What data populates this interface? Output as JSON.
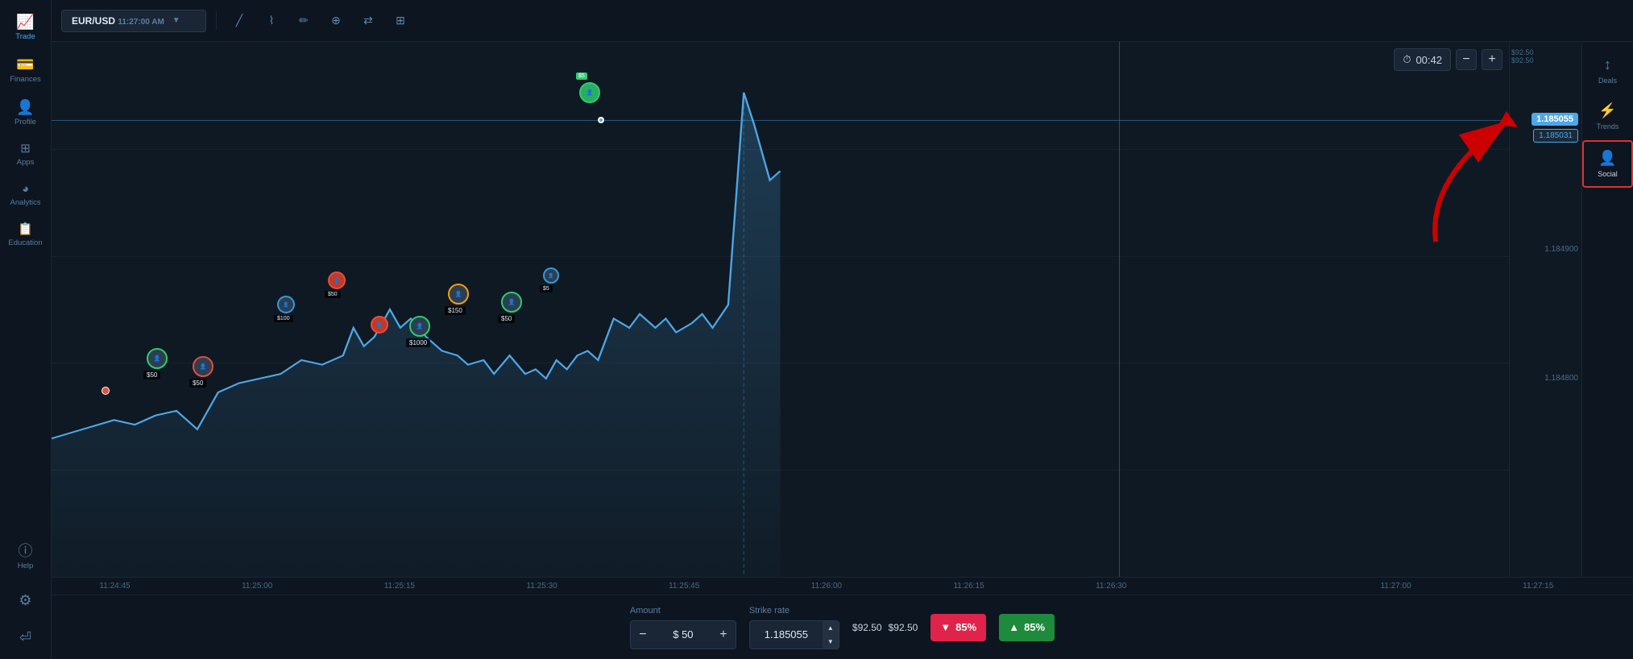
{
  "sidebar": {
    "items": [
      {
        "id": "trade",
        "label": "Trade",
        "icon": "📈",
        "active": true
      },
      {
        "id": "finances",
        "label": "Finances",
        "icon": "💳",
        "active": false
      },
      {
        "id": "profile",
        "label": "Profile",
        "icon": "👤",
        "active": false
      },
      {
        "id": "apps",
        "label": "Apps",
        "icon": "⊞",
        "active": false
      },
      {
        "id": "analytics",
        "label": "Analytics",
        "icon": "◕",
        "active": false
      },
      {
        "id": "education",
        "label": "Education",
        "icon": "📋",
        "active": false
      },
      {
        "id": "help",
        "label": "Help",
        "icon": "ⓘ",
        "active": false
      }
    ],
    "bottom_items": [
      {
        "id": "settings",
        "label": "",
        "icon": "⚙"
      },
      {
        "id": "logout",
        "label": "",
        "icon": "⏎"
      }
    ]
  },
  "topbar": {
    "pair": "EUR/USD",
    "time": "11:27:00 AM",
    "tools": [
      {
        "id": "line",
        "icon": "╱"
      },
      {
        "id": "zigzag",
        "icon": "⌇"
      },
      {
        "id": "pencil",
        "icon": "✏"
      },
      {
        "id": "crosshair",
        "icon": "⊕"
      },
      {
        "id": "arrows",
        "icon": "⇄"
      },
      {
        "id": "grid",
        "icon": "⊞"
      }
    ]
  },
  "timer": {
    "display": "00:42",
    "minus": "−",
    "plus": "+"
  },
  "right_sidebar": {
    "items": [
      {
        "id": "deals",
        "label": "Deals",
        "icon": "↕"
      },
      {
        "id": "trends",
        "label": "Trends",
        "icon": "⚡"
      },
      {
        "id": "social",
        "label": "Social",
        "icon": "👤+",
        "active": true
      }
    ]
  },
  "price_axis": {
    "current_price": "1.185055",
    "current_price_alt": "1.185031",
    "labels": [
      {
        "value": "1.184900",
        "y_pct": 40
      },
      {
        "value": "1.184800",
        "y_pct": 65
      }
    ],
    "top_labels": [
      {
        "value": "$92.50",
        "y_pct": 10,
        "type": "small"
      },
      {
        "value": "$92.50",
        "y_pct": 12,
        "type": "small"
      }
    ]
  },
  "bottom_bar": {
    "amount_label": "Amount",
    "amount_value": "$ 50",
    "minus": "−",
    "plus": "+",
    "strike_label": "Strike rate",
    "strike_value": "1.185055",
    "sell_amount": "$92.50",
    "buy_amount": "$92.50",
    "sell_pct": "▼ 85%",
    "buy_pct": "▲ 85%"
  },
  "time_axis": {
    "ticks": [
      {
        "label": "11:24:45",
        "pct": 4
      },
      {
        "label": "11:25:00",
        "pct": 12
      },
      {
        "label": "11:25:15",
        "pct": 21
      },
      {
        "label": "11:25:30",
        "pct": 30
      },
      {
        "label": "11:25:45",
        "pct": 39
      },
      {
        "label": "11:26:00",
        "pct": 48
      },
      {
        "label": "11:26:15",
        "pct": 57
      },
      {
        "label": "11:26:30",
        "pct": 66
      },
      {
        "label": "11:27:00",
        "pct": 84
      },
      {
        "label": "11:27:15",
        "pct": 93
      }
    ]
  },
  "chart": {
    "line_color": "#4da8e8",
    "fill_color": "rgba(77,168,232,0.15)"
  },
  "colors": {
    "bg_dark": "#0d1520",
    "bg_main": "#0f1923",
    "accent_blue": "#4da8e8",
    "sell_red": "#e0234a",
    "buy_green": "#1e8a3c",
    "border": "#1a2535"
  }
}
